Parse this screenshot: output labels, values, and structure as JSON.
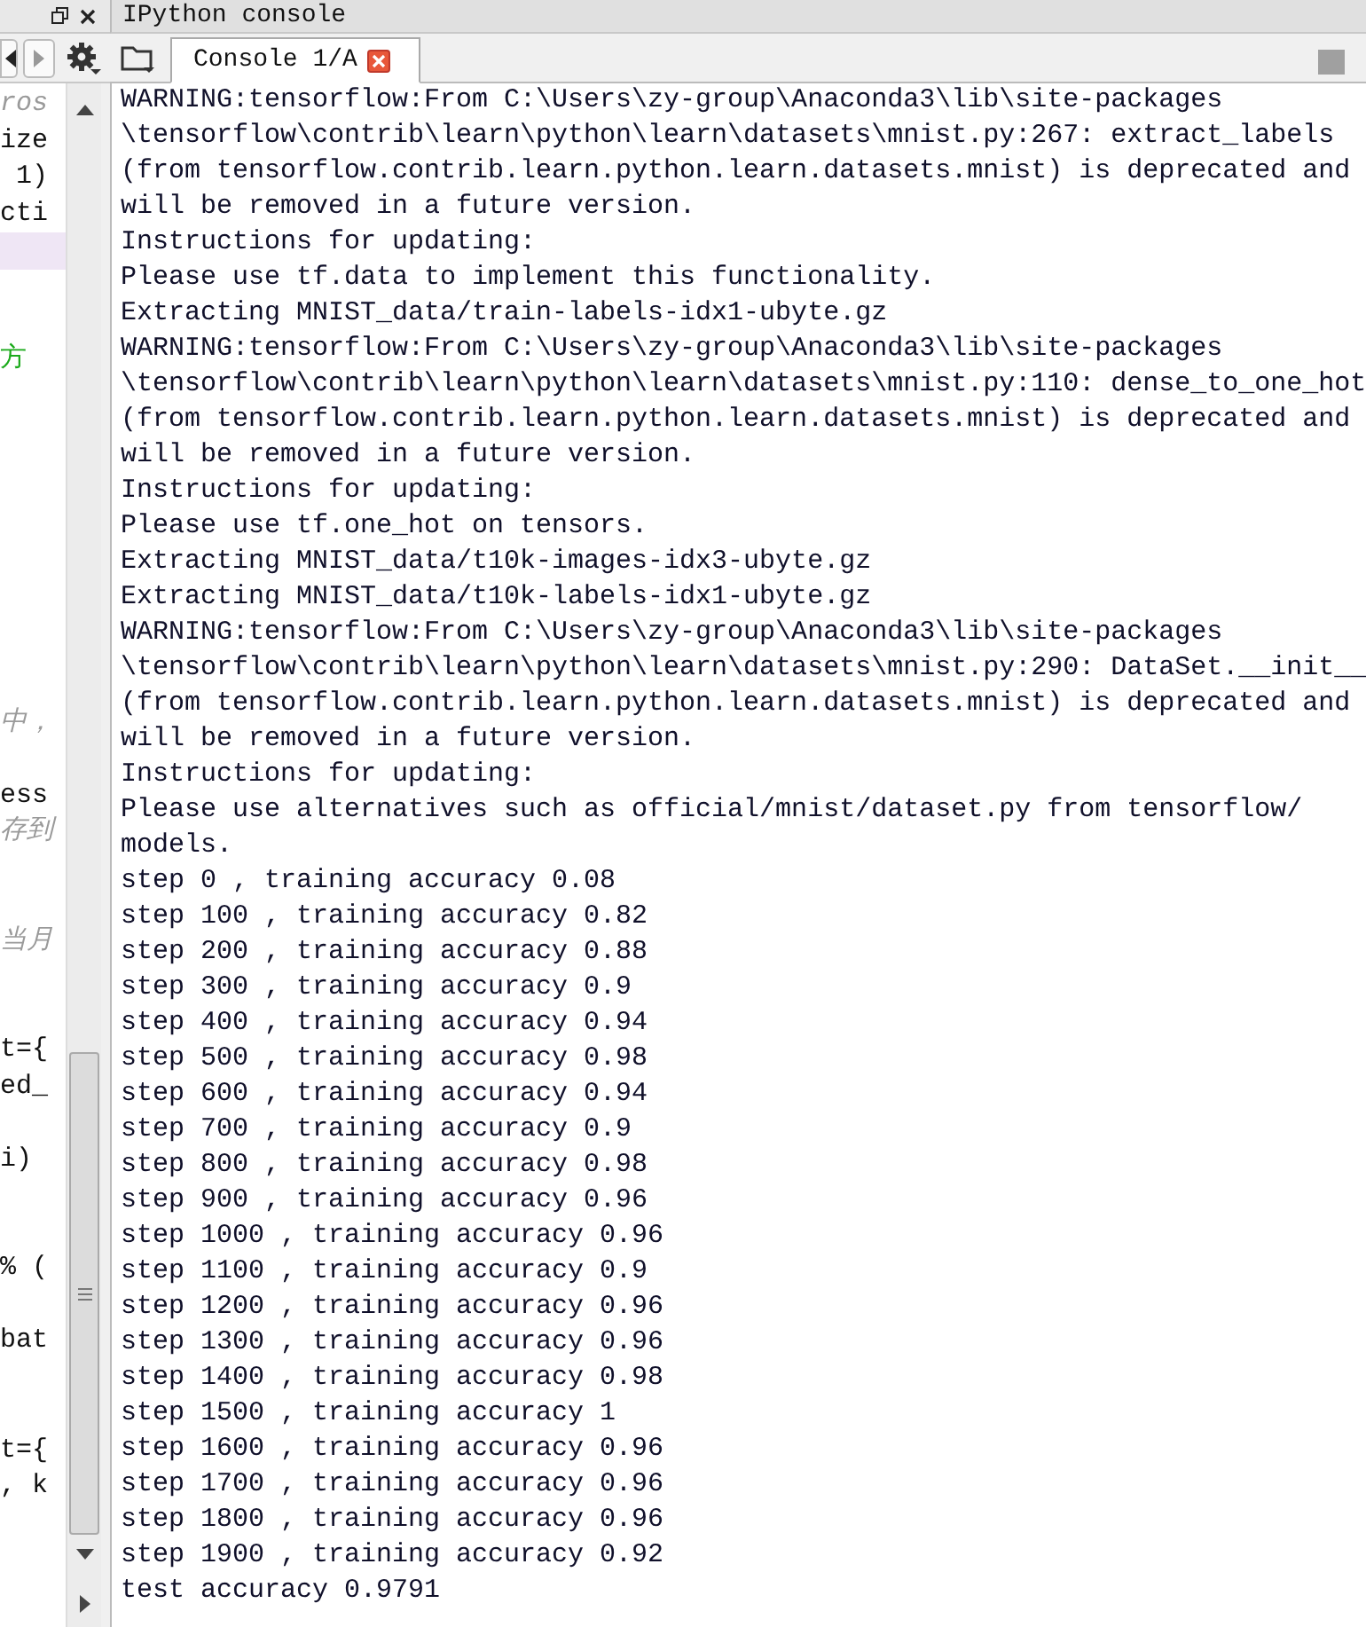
{
  "editor_pane": {
    "lines": [
      {
        "kind": "comment",
        "text": "ros"
      },
      {
        "kind": "code",
        "text": "ize"
      },
      {
        "kind": "code",
        "text": " 1)"
      },
      {
        "kind": "code",
        "text": "cti"
      },
      {
        "kind": "current_line"
      },
      {
        "kind": "blank"
      },
      {
        "kind": "blank"
      },
      {
        "kind": "string",
        "text": "方"
      },
      {
        "kind": "blank"
      },
      {
        "kind": "blank"
      },
      {
        "kind": "blank"
      },
      {
        "kind": "blank"
      },
      {
        "kind": "blank"
      },
      {
        "kind": "blank"
      },
      {
        "kind": "blank"
      },
      {
        "kind": "blank"
      },
      {
        "kind": "blank"
      },
      {
        "kind": "comment",
        "text": "中，"
      },
      {
        "kind": "blank"
      },
      {
        "kind": "code",
        "text": "ess"
      },
      {
        "kind": "comment",
        "text": "存到"
      },
      {
        "kind": "blank"
      },
      {
        "kind": "blank"
      },
      {
        "kind": "comment",
        "text": "当月"
      },
      {
        "kind": "blank"
      },
      {
        "kind": "blank"
      },
      {
        "kind": "code",
        "text": "t={"
      },
      {
        "kind": "code",
        "text": "ed_"
      },
      {
        "kind": "blank"
      },
      {
        "kind": "code",
        "text": "i)"
      },
      {
        "kind": "blank"
      },
      {
        "kind": "blank"
      },
      {
        "kind": "code",
        "text": "% ("
      },
      {
        "kind": "blank"
      },
      {
        "kind": "code",
        "text": "bat"
      },
      {
        "kind": "blank"
      },
      {
        "kind": "blank"
      },
      {
        "kind": "code",
        "text": "t={"
      },
      {
        "kind": "code",
        "text": ", k"
      }
    ]
  },
  "console_pane": {
    "title": "IPython console",
    "tabs": [
      {
        "label": "Console 1/A",
        "selected": true
      }
    ],
    "lines": [
      "WARNING:tensorflow:From C:\\Users\\zy-group\\Anaconda3\\lib\\site-packages",
      "\\tensorflow\\contrib\\learn\\python\\learn\\datasets\\mnist.py:267: extract_labels",
      "(from tensorflow.contrib.learn.python.learn.datasets.mnist) is deprecated and",
      "will be removed in a future version.",
      "Instructions for updating:",
      "Please use tf.data to implement this functionality.",
      "Extracting MNIST_data/train-labels-idx1-ubyte.gz",
      "WARNING:tensorflow:From C:\\Users\\zy-group\\Anaconda3\\lib\\site-packages",
      "\\tensorflow\\contrib\\learn\\python\\learn\\datasets\\mnist.py:110: dense_to_one_hot",
      "(from tensorflow.contrib.learn.python.learn.datasets.mnist) is deprecated and",
      "will be removed in a future version.",
      "Instructions for updating:",
      "Please use tf.one_hot on tensors.",
      "Extracting MNIST_data/t10k-images-idx3-ubyte.gz",
      "Extracting MNIST_data/t10k-labels-idx1-ubyte.gz",
      "WARNING:tensorflow:From C:\\Users\\zy-group\\Anaconda3\\lib\\site-packages",
      "\\tensorflow\\contrib\\learn\\python\\learn\\datasets\\mnist.py:290: DataSet.__init__",
      "(from tensorflow.contrib.learn.python.learn.datasets.mnist) is deprecated and",
      "will be removed in a future version.",
      "Instructions for updating:",
      "Please use alternatives such as official/mnist/dataset.py from tensorflow/",
      "models.",
      "step 0 , training accuracy 0.08",
      "step 100 , training accuracy 0.82",
      "step 200 , training accuracy 0.88",
      "step 300 , training accuracy 0.9",
      "step 400 , training accuracy 0.94",
      "step 500 , training accuracy 0.98",
      "step 600 , training accuracy 0.94",
      "step 700 , training accuracy 0.9",
      "step 800 , training accuracy 0.98",
      "step 900 , training accuracy 0.96",
      "step 1000 , training accuracy 0.96",
      "step 1100 , training accuracy 0.9",
      "step 1200 , training accuracy 0.96",
      "step 1300 , training accuracy 0.96",
      "step 1400 , training accuracy 0.98",
      "step 1500 , training accuracy 1",
      "step 1600 , training accuracy 0.96",
      "step 1700 , training accuracy 0.96",
      "step 1800 , training accuracy 0.96",
      "step 1900 , training accuracy 0.92",
      "test accuracy 0.9791"
    ]
  }
}
